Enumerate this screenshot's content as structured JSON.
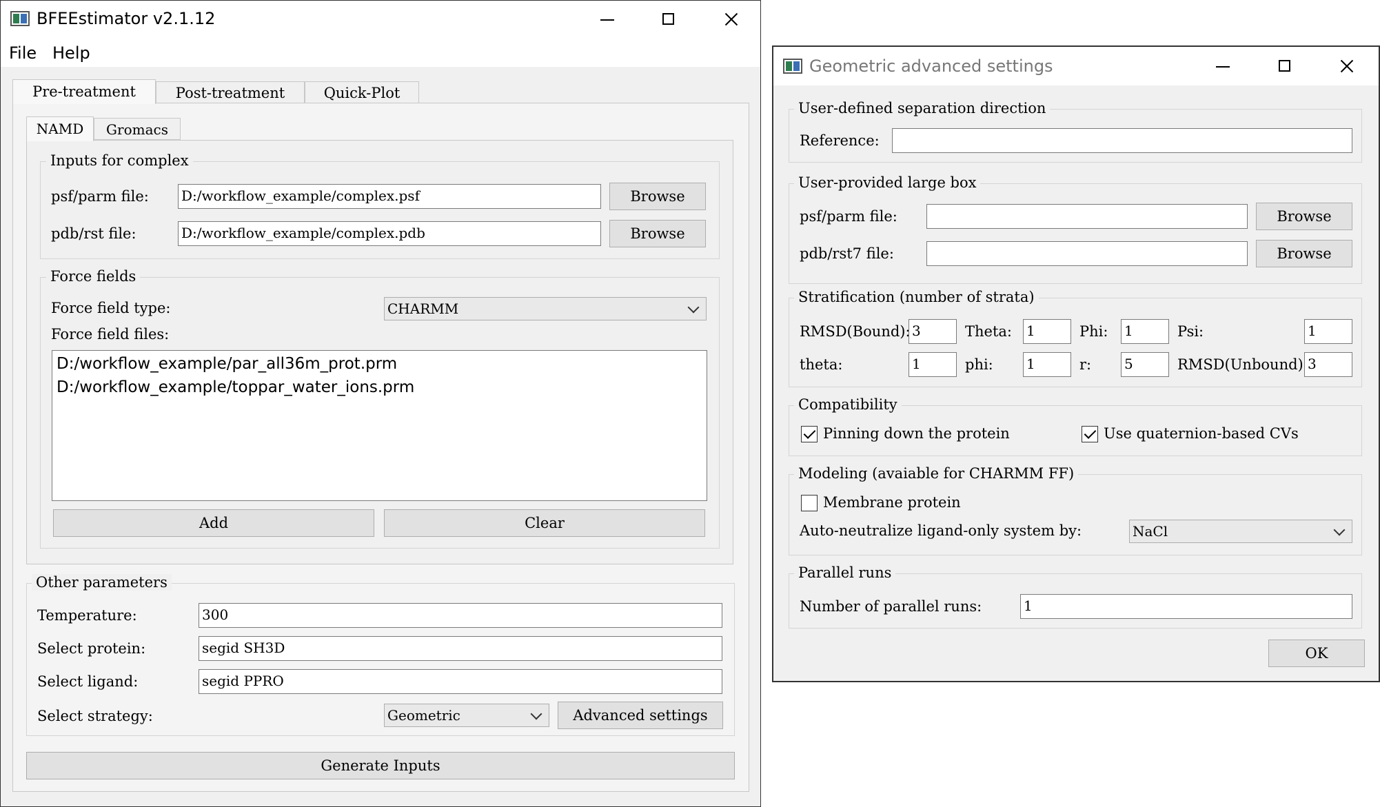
{
  "main_window": {
    "title": "BFEEstimator v2.1.12",
    "menu": [
      "File",
      "Help"
    ],
    "tabs": [
      "Pre-treatment",
      "Post-treatment",
      "Quick-Plot"
    ],
    "subtabs": [
      "NAMD",
      "Gromacs"
    ],
    "inputs_group": {
      "legend": "Inputs for complex",
      "psf_label": "psf/parm file:",
      "psf_value": "D:/workflow_example/complex.psf",
      "pdb_label": "pdb/rst file:",
      "pdb_value": "D:/workflow_example/complex.pdb",
      "browse_label": "Browse"
    },
    "force_fields": {
      "legend": "Force fields",
      "type_label": "Force field type:",
      "type_value": "CHARMM",
      "files_label": "Force field files:",
      "files": [
        "D:/workflow_example/par_all36m_prot.prm",
        "D:/workflow_example/toppar_water_ions.prm"
      ],
      "add_label": "Add",
      "clear_label": "Clear"
    },
    "other": {
      "legend": "Other parameters",
      "temperature_label": "Temperature:",
      "temperature_value": "300",
      "protein_label": "Select protein:",
      "protein_value": "segid SH3D",
      "ligand_label": "Select ligand:",
      "ligand_value": "segid PPRO",
      "strategy_label": "Select strategy:",
      "strategy_value": "Geometric",
      "advanced_label": "Advanced settings"
    },
    "generate_label": "Generate Inputs"
  },
  "dialog": {
    "title": "Geometric advanced settings",
    "separation": {
      "legend": "User-defined separation direction",
      "reference_label": "Reference:",
      "reference_value": ""
    },
    "large_box": {
      "legend": "User-provided large box",
      "psf_label": "psf/parm file:",
      "pdb_label": "pdb/rst7 file:",
      "browse_label": "Browse"
    },
    "strata": {
      "legend": "Stratification (number of strata)",
      "rmsd_bound_label": "RMSD(Bound):",
      "rmsd_bound_value": "3",
      "theta_upper_label": "Theta:",
      "theta_upper_value": "1",
      "phi_upper_label": "Phi:",
      "phi_upper_value": "1",
      "psi_label": "Psi:",
      "psi_value": "1",
      "theta_label": "theta:",
      "theta_value": "1",
      "phi_label": "phi:",
      "phi_value": "1",
      "r_label": "r:",
      "r_value": "5",
      "rmsd_unbound_label": "RMSD(Unbound):",
      "rmsd_unbound_value": "3"
    },
    "compat": {
      "legend": "Compatibility",
      "pinning_label": "Pinning down the protein",
      "pinning_checked": true,
      "quaternion_label": "Use quaternion-based CVs",
      "quaternion_checked": true
    },
    "modeling": {
      "legend": "Modeling (avaiable for CHARMM FF)",
      "membrane_label": "Membrane protein",
      "membrane_checked": false,
      "neutralize_label": "Auto-neutralize ligand-only system by:",
      "neutralize_value": "NaCl"
    },
    "parallel": {
      "legend": "Parallel runs",
      "runs_label": "Number of parallel runs:",
      "runs_value": "1"
    },
    "ok_label": "OK"
  }
}
